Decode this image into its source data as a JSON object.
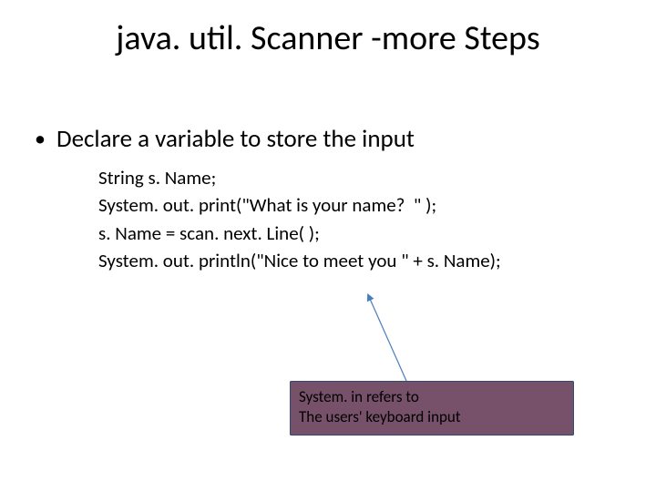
{
  "title": "java. util. Scanner -more Steps",
  "bullet": {
    "dot": "•",
    "text": "Declare a variable to store the input"
  },
  "code": {
    "l1": "String s. Name;",
    "l2": "System. out. print(\"What is your name?  \" );",
    "l3": "s. Name = scan. next. Line( );",
    "l4": "System. out. println(\"Nice to meet you \" + s. Name);"
  },
  "callout": {
    "line1": "System. in refers to",
    "line2": "The users' keyboard input"
  },
  "colors": {
    "callout_fill": "#B23A33",
    "callout_overlay": "rgba(70,100,150,0.55)",
    "callout_border": "#2E4B73",
    "arrow": "#4A7EBB"
  }
}
